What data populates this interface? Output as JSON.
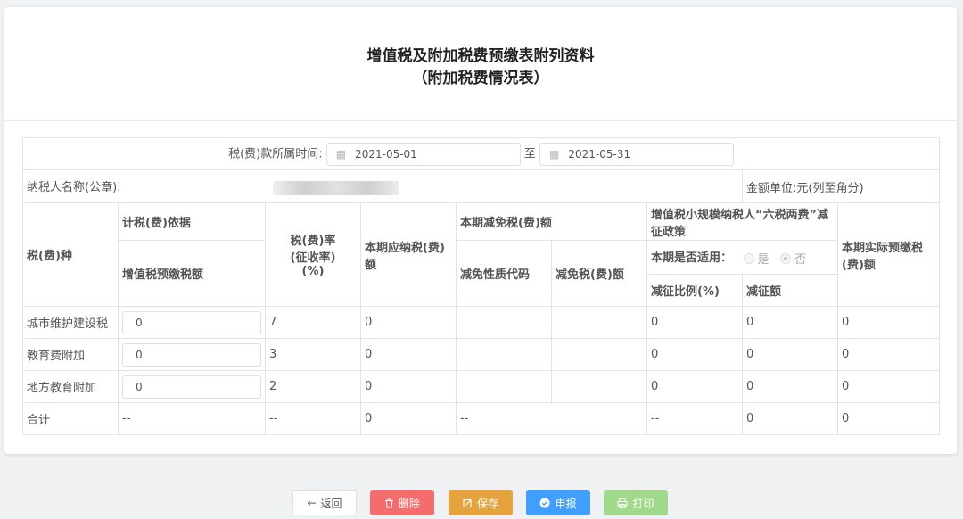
{
  "title": {
    "line1": "增值税及附加税费预缴表附列资料",
    "line2": "（附加税费情况表）"
  },
  "period": {
    "label": "税(费)款所属时间:",
    "start": "2021-05-01",
    "separator": "至",
    "end": "2021-05-31"
  },
  "taxpayer": {
    "label": "纳税人名称(公章):",
    "unit_label": "金额单位:元(列至角分)"
  },
  "headers": {
    "tax_type": "税(费)种",
    "basis": "计税(费)依据",
    "vat_prepaid": "增值税预缴税额",
    "rate": "税(费)率\n(征收率)\n(%)",
    "payable": "本期应纳税(费)额",
    "reduction": "本期减免税(费)额",
    "reduction_code": "减免性质代码",
    "reduction_amount": "减免税(费)额",
    "policy": "增值税小规模纳税人“六税两费”减征政策",
    "applicable": "本期是否适用：",
    "yes": "是",
    "no": "否",
    "ratio": "减征比例(%)",
    "reduced_amount": "减征额",
    "actual": "本期实际预缴税(费)额"
  },
  "rows": [
    {
      "name": "城市维护建设税",
      "vat": "0",
      "rate": "7",
      "payable": "0",
      "code": "",
      "reduce": "",
      "ratio": "0",
      "reduced": "0",
      "actual": "0"
    },
    {
      "name": "教育费附加",
      "vat": "0",
      "rate": "3",
      "payable": "0",
      "code": "",
      "reduce": "",
      "ratio": "0",
      "reduced": "0",
      "actual": "0"
    },
    {
      "name": "地方教育附加",
      "vat": "0",
      "rate": "2",
      "payable": "0",
      "code": "",
      "reduce": "",
      "ratio": "0",
      "reduced": "0",
      "actual": "0"
    }
  ],
  "total": {
    "name": "合计",
    "vat": "--",
    "rate": "--",
    "payable": "0",
    "code": "--",
    "ratio": "--",
    "reduced": "0",
    "actual": "0"
  },
  "buttons": {
    "back": "返回",
    "delete": "删除",
    "save": "保存",
    "report": "申报",
    "print": "打印"
  },
  "colors": {
    "delete": "#f56c6c",
    "save": "#e6a23c",
    "report": "#409eff",
    "print": "#a0d98a"
  }
}
